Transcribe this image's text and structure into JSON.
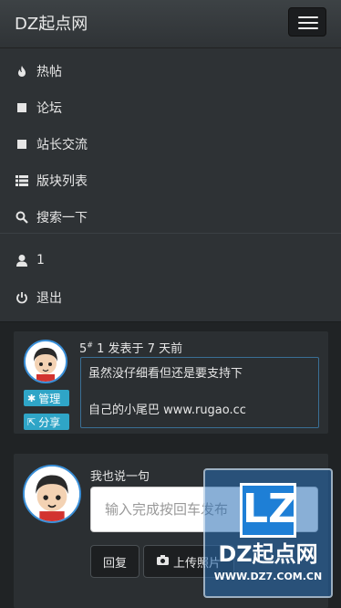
{
  "header": {
    "brand": "DZ起点网"
  },
  "nav": {
    "items": [
      {
        "label": "热帖",
        "icon": "fire-icon"
      },
      {
        "label": "论坛",
        "icon": "square-icon"
      },
      {
        "label": "站长交流",
        "icon": "square-icon"
      },
      {
        "label": "版块列表",
        "icon": "list-icon"
      },
      {
        "label": "搜索一下",
        "icon": "search-icon"
      }
    ],
    "user": {
      "label": "1",
      "icon": "user-icon"
    },
    "logout": {
      "label": "退出",
      "icon": "power-icon"
    }
  },
  "post": {
    "floor": "5",
    "floor_sup": "#",
    "author": "1",
    "posted_label": "发表于",
    "time": "7 天前",
    "content_line1": "虽然没仔细看但还是要支持下",
    "content_line2": "自己的小尾巴 www.rugao.cc",
    "manage_label": "管理",
    "share_label": "分享"
  },
  "reply": {
    "title": "我也说一句",
    "placeholder": "输入完成按回车发布",
    "reply_button": "回复",
    "upload_button": "上传照片"
  },
  "watermark": {
    "logo": "LZ",
    "text": "DZ起点网",
    "url": "WWW.DZ7.COM.CN"
  },
  "colors": {
    "accent": "#2fa5c7",
    "topbar": "#3a3f42",
    "panel": "#2b2f32",
    "border_blue": "#3a8fd8"
  }
}
